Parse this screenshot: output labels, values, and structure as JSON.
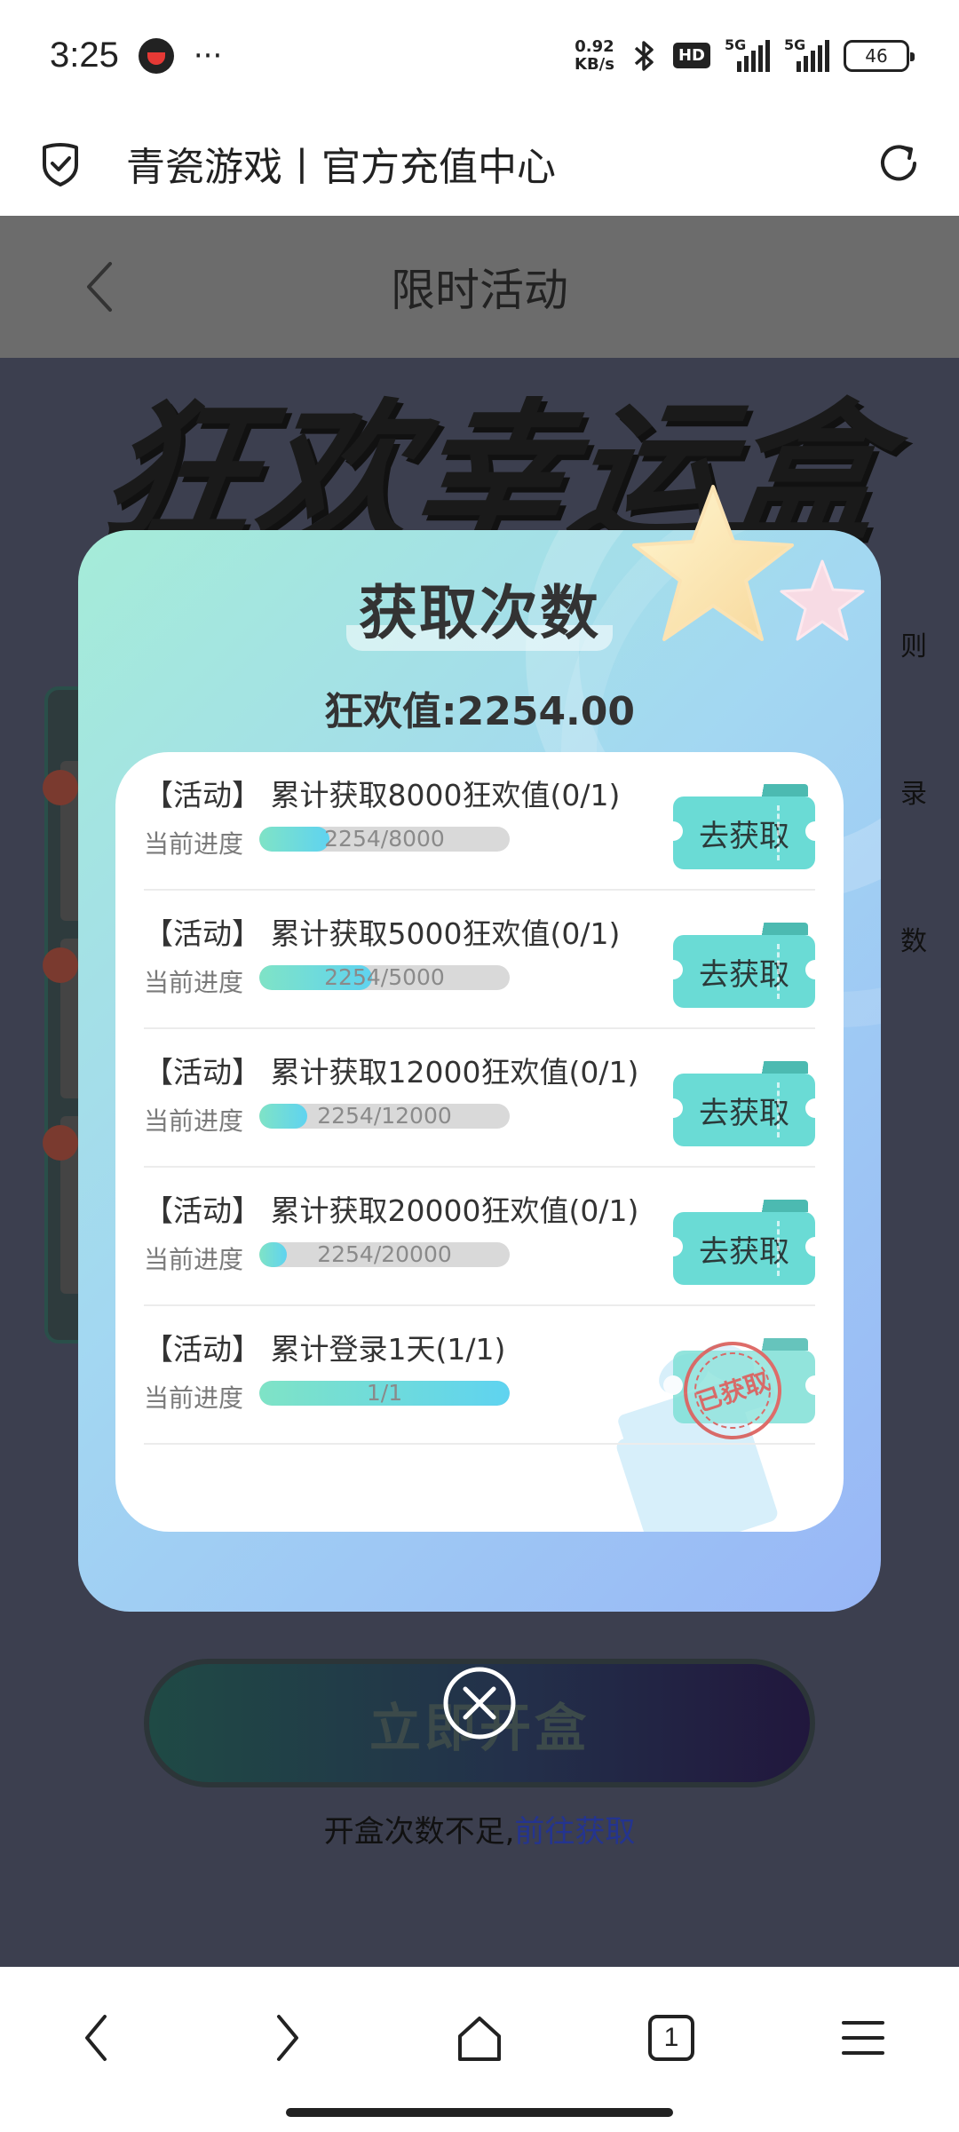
{
  "status_bar": {
    "time": "3:25",
    "dots": "···",
    "net_speed_value": "0.92",
    "net_speed_unit": "KB/s",
    "hd_label": "HD",
    "signal1_label": "5G",
    "signal2_label": "5G",
    "battery": "46"
  },
  "address_bar": {
    "title": "青瓷游戏丨官方充值中心"
  },
  "page": {
    "title": "限时活动",
    "banner": "狂欢幸运盒",
    "side_tabs": [
      "则",
      "录",
      "数"
    ],
    "open_button": "立即开盒",
    "hint_text": "开盒次数不足,",
    "hint_link": "前往获取"
  },
  "modal": {
    "title": "获取次数",
    "score_label": "狂欢值:",
    "score_value": "2254.00",
    "progress_label": "当前进度",
    "tasks": [
      {
        "name": "【活动】 累计获取8000狂欢值(0/1)",
        "progress_text": "2254/8000",
        "progress": 0.28,
        "button": "去获取",
        "claimed": false
      },
      {
        "name": "【活动】 累计获取5000狂欢值(0/1)",
        "progress_text": "2254/5000",
        "progress": 0.45,
        "button": "去获取",
        "claimed": false
      },
      {
        "name": "【活动】 累计获取12000狂欢值(0/1)",
        "progress_text": "2254/12000",
        "progress": 0.19,
        "button": "去获取",
        "claimed": false
      },
      {
        "name": "【活动】 累计获取20000狂欢值(0/1)",
        "progress_text": "2254/20000",
        "progress": 0.11,
        "button": "去获取",
        "claimed": false
      },
      {
        "name": "【活动】 累计登录1天(1/1)",
        "progress_text": "1/1",
        "progress": 1.0,
        "button": "",
        "claimed": true,
        "stamp": "已获取"
      }
    ]
  },
  "bottom_nav": {
    "tab_count": "1"
  },
  "icons": {
    "shield": "shield-check-icon",
    "refresh": "refresh-icon",
    "back": "chevron-left-icon",
    "close": "close-circle-icon",
    "nav_back": "chevron-left-icon",
    "nav_forward": "chevron-right-icon",
    "home": "home-icon",
    "tabs": "tabs-icon",
    "menu": "menu-icon"
  }
}
